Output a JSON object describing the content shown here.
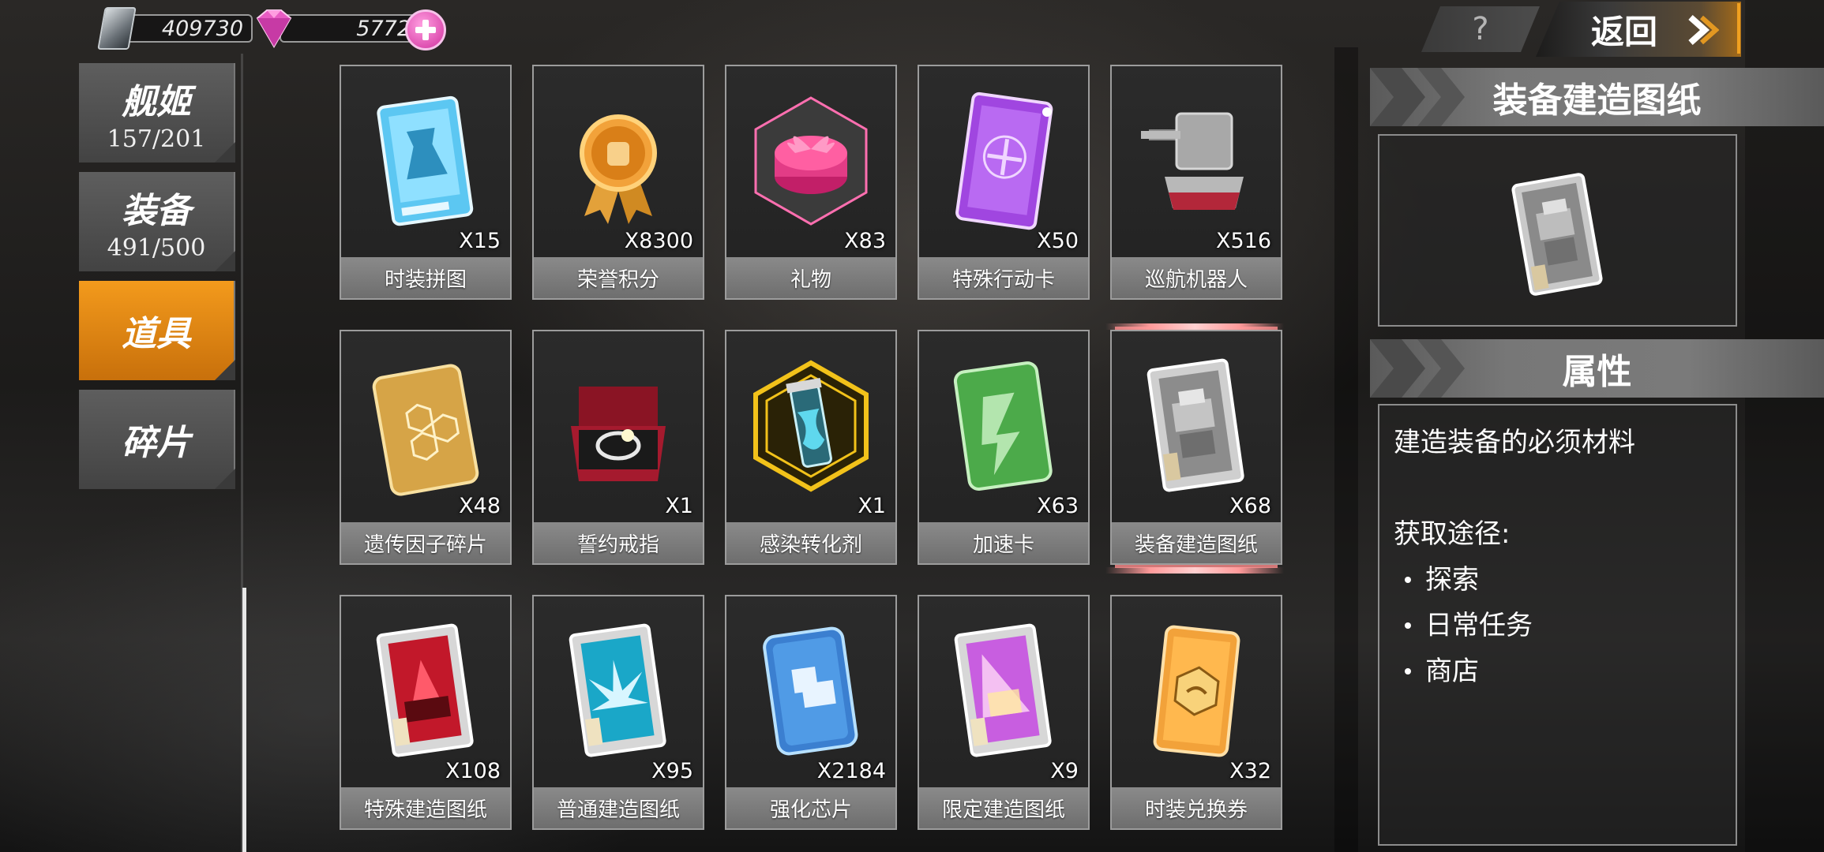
{
  "resources": {
    "fuel_value": "409730",
    "gem_value": "5772"
  },
  "topbar": {
    "help_label": "?",
    "back_label": "返回"
  },
  "tabs": [
    {
      "label": "舰姬",
      "count": "157/201",
      "active": false
    },
    {
      "label": "装备",
      "count": "491/500",
      "active": false
    },
    {
      "label": "道具",
      "count": "",
      "active": true
    },
    {
      "label": "碎片",
      "count": "",
      "active": false
    }
  ],
  "items": [
    {
      "name": "时装拼图",
      "qty": "X15",
      "icon": "costume-puzzle-card-icon"
    },
    {
      "name": "荣誉积分",
      "qty": "X8300",
      "icon": "honor-medal-icon"
    },
    {
      "name": "礼物",
      "qty": "X83",
      "icon": "gift-box-icon"
    },
    {
      "name": "特殊行动卡",
      "qty": "X50",
      "icon": "special-operation-card-icon"
    },
    {
      "name": "巡航机器人",
      "qty": "X516",
      "icon": "cruise-robot-turret-icon"
    },
    {
      "name": "遗传因子碎片",
      "qty": "X48",
      "icon": "gene-fragment-icon"
    },
    {
      "name": "誓约戒指",
      "qty": "X1",
      "icon": "oath-ring-icon"
    },
    {
      "name": "感染转化剂",
      "qty": "X1",
      "icon": "infection-converter-vial-icon"
    },
    {
      "name": "加速卡",
      "qty": "X63",
      "icon": "speedup-card-icon"
    },
    {
      "name": "装备建造图纸",
      "qty": "X68",
      "icon": "equipment-blueprint-icon",
      "selected": true
    },
    {
      "name": "特殊建造图纸",
      "qty": "X108",
      "icon": "special-blueprint-icon"
    },
    {
      "name": "普通建造图纸",
      "qty": "X95",
      "icon": "normal-blueprint-icon"
    },
    {
      "name": "强化芯片",
      "qty": "X2184",
      "icon": "enhance-chip-icon"
    },
    {
      "name": "限定建造图纸",
      "qty": "X9",
      "icon": "limited-blueprint-icon"
    },
    {
      "name": "时装兑换券",
      "qty": "X32",
      "icon": "costume-voucher-icon"
    }
  ],
  "detail": {
    "title": "装备建造图纸",
    "attr_header": "属性",
    "description": "建造装备的必须材料",
    "source_label": "获取途径:",
    "sources": [
      "探索",
      "日常任务",
      "商店"
    ]
  },
  "colors": {
    "accent_orange": "#f39a1c",
    "gem_pink": "#e04fb8",
    "tile_border": "#9c9c9c"
  }
}
